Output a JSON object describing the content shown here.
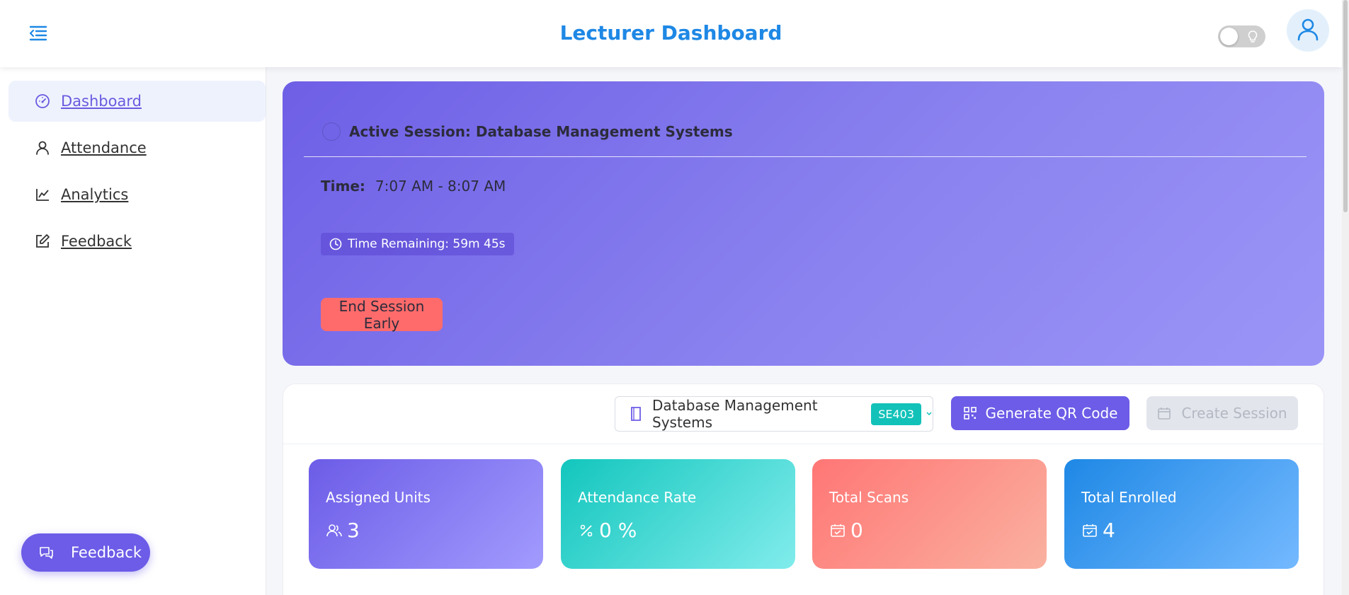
{
  "header": {
    "title": "Lecturer Dashboard",
    "menu_icon": "menu-collapse-icon",
    "theme_icon": "lightbulb-icon",
    "avatar_icon": "user-icon"
  },
  "sidebar": {
    "items": [
      {
        "label": "Dashboard",
        "icon": "dashboard-gauge-icon",
        "active": true
      },
      {
        "label": "Attendance",
        "icon": "user-icon",
        "active": false
      },
      {
        "label": "Analytics",
        "icon": "line-chart-icon",
        "active": false
      },
      {
        "label": "Feedback",
        "icon": "edit-icon",
        "active": false
      }
    ]
  },
  "feedback_fab": {
    "label": "Feedback",
    "icon": "chat-icon"
  },
  "session": {
    "title": "Active Session: Database Management Systems",
    "time_label": "Time:",
    "time_value": "7:07 AM - 8:07 AM",
    "remaining": "Time Remaining: 59m 45s",
    "end_button": "End Session Early"
  },
  "toolbar": {
    "unit_name": "Database Management Systems",
    "unit_code": "SE403",
    "generate_qr": "Generate QR Code",
    "create_session": "Create Session"
  },
  "stats": [
    {
      "label": "Assigned Units",
      "value": "3",
      "icon": "users-icon"
    },
    {
      "label": "Attendance Rate",
      "value": "0 %",
      "icon": "percent-icon"
    },
    {
      "label": "Total Scans",
      "value": "0",
      "icon": "calendar-check-icon"
    },
    {
      "label": "Total Enrolled",
      "value": "4",
      "icon": "calendar-check-icon"
    }
  ],
  "colors": {
    "accent": "#6c5ce7",
    "brand_blue": "#1e88e5",
    "danger": "#ff6b6b",
    "teal": "#12c2b9"
  }
}
